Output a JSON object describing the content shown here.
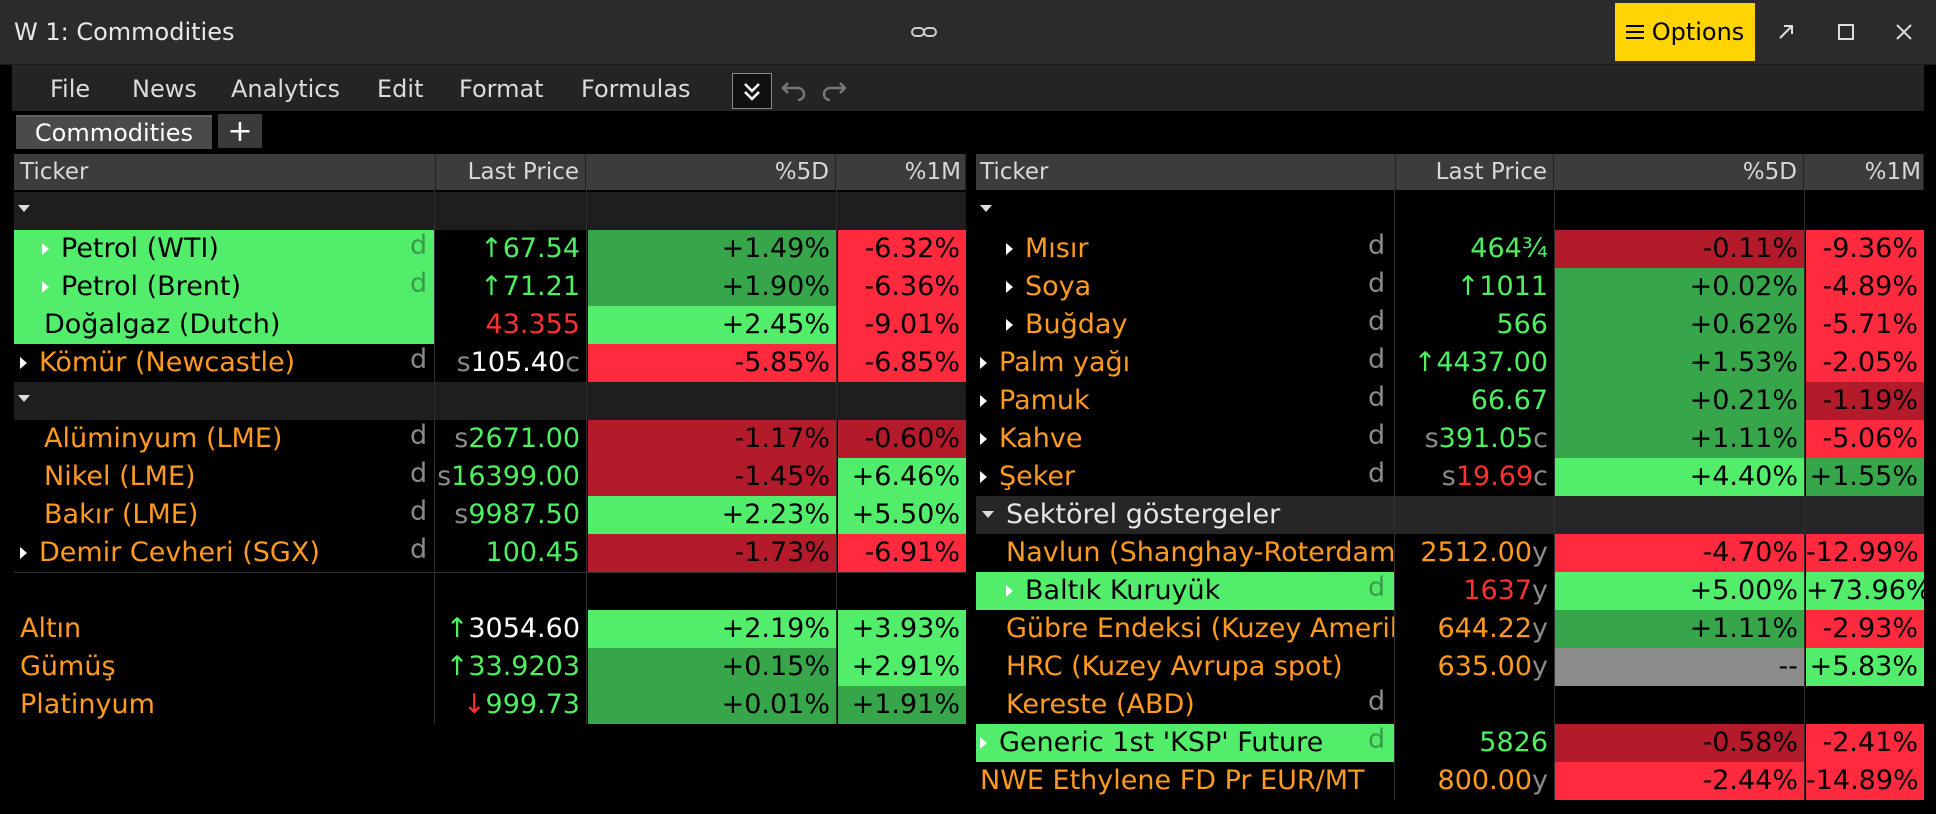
{
  "window": {
    "title": "W 1: Commodities",
    "options_label": "Options"
  },
  "menu": [
    "File",
    "News",
    "Analytics",
    "Edit",
    "Format",
    "Formulas"
  ],
  "tab": {
    "active": "Commodities",
    "add": "+"
  },
  "headers": {
    "ticker": "Ticker",
    "last": "Last Price",
    "d5": "%5D",
    "m1": "%1M"
  },
  "left": {
    "energy": [
      {
        "name": "Petrol (WTI)",
        "d": "d",
        "prefix": "↑",
        "price": "67.54",
        "suffix": "",
        "d5": "+1.49%",
        "m1": "-6.32%"
      },
      {
        "name": "Petrol (Brent)",
        "d": "d",
        "prefix": "↑",
        "price": "71.21",
        "suffix": "",
        "d5": "+1.90%",
        "m1": "-6.36%"
      },
      {
        "name": "Doğalgaz (Dutch)",
        "d": "",
        "prefix": "",
        "price": "43.355",
        "suffix": "",
        "d5": "+2.45%",
        "m1": "-9.01%"
      },
      {
        "name": "Kömür (Newcastle)",
        "d": "d",
        "prefix": "s",
        "price": "105.40",
        "suffix": "c",
        "d5": "-5.85%",
        "m1": "-6.85%"
      }
    ],
    "metals": [
      {
        "name": "Alüminyum (LME)",
        "d": "d",
        "prefix": "s",
        "price": "2671.00",
        "suffix": "",
        "d5": "-1.17%",
        "m1": "-0.60%"
      },
      {
        "name": "Nikel (LME)",
        "d": "d",
        "prefix": "s",
        "price": "16399.00",
        "suffix": "",
        "d5": "-1.45%",
        "m1": "+6.46%"
      },
      {
        "name": "Bakır (LME)",
        "d": "d",
        "prefix": "s",
        "price": "9987.50",
        "suffix": "",
        "d5": "+2.23%",
        "m1": "+5.50%"
      },
      {
        "name": "Demir Cevheri (SGX)",
        "d": "d",
        "prefix": "",
        "price": "100.45",
        "suffix": "",
        "d5": "-1.73%",
        "m1": "-6.91%"
      }
    ],
    "precious": [
      {
        "name": "Altın",
        "prefix": "↑",
        "price": "3054.60",
        "d5": "+2.19%",
        "m1": "+3.93%"
      },
      {
        "name": "Gümüş",
        "prefix": "↑",
        "price": "33.9203",
        "d5": "+0.15%",
        "m1": "+2.91%"
      },
      {
        "name": "Platinyum",
        "prefix": "↓",
        "price": "999.73",
        "d5": "+0.01%",
        "m1": "+1.91%"
      }
    ]
  },
  "right": {
    "agri": [
      {
        "name": "Mısır",
        "d": "d",
        "prefix": "",
        "price": "464¾",
        "suffix": "",
        "d5": "-0.11%",
        "m1": "-9.36%"
      },
      {
        "name": "Soya",
        "d": "d",
        "prefix": "↑",
        "price": "1011",
        "suffix": "",
        "d5": "+0.02%",
        "m1": "-4.89%"
      },
      {
        "name": "Buğday",
        "d": "d",
        "prefix": "",
        "price": "566",
        "suffix": "",
        "d5": "+0.62%",
        "m1": "-5.71%"
      },
      {
        "name": "Palm yağı",
        "d": "d",
        "prefix": "↑",
        "price": "4437.00",
        "suffix": "",
        "d5": "+1.53%",
        "m1": "-2.05%"
      },
      {
        "name": "Pamuk",
        "d": "d",
        "prefix": "",
        "price": "66.67",
        "suffix": "",
        "d5": "+0.21%",
        "m1": "-1.19%"
      },
      {
        "name": "Kahve",
        "d": "d",
        "prefix": "s",
        "price": "391.05",
        "suffix": "c",
        "d5": "+1.11%",
        "m1": "-5.06%"
      },
      {
        "name": "Şeker",
        "d": "d",
        "prefix": "s",
        "price": "19.69",
        "suffix": "c",
        "d5": "+4.40%",
        "m1": "+1.55%"
      }
    ],
    "sector_title": "Sektörel göstergeler",
    "sector": [
      {
        "name": "Navlun (Shanghay-Roterdam",
        "d": "",
        "price": "2512.00",
        "suffix": "y",
        "d5": "-4.70%",
        "m1": "-12.99%"
      },
      {
        "name": "Baltık Kuruyük",
        "d": "d",
        "price": "1637",
        "suffix": "y",
        "d5": "+5.00%",
        "m1": "+73.96%"
      },
      {
        "name": "Gübre Endeksi (Kuzey Amerika",
        "d": "",
        "price": "644.22",
        "suffix": "y",
        "d5": "+1.11%",
        "m1": "-2.93%"
      },
      {
        "name": "HRC (Kuzey Avrupa spot)",
        "d": "",
        "price": "635.00",
        "suffix": "y",
        "d5": "--",
        "m1": "+5.83%"
      },
      {
        "name": "Kereste (ABD)",
        "d": "d",
        "price": "",
        "suffix": "",
        "d5": "",
        "m1": ""
      },
      {
        "name": "Generic 1st 'KSP' Future",
        "d": "d",
        "price": "5826",
        "suffix": "",
        "d5": "-0.58%",
        "m1": "-2.41%"
      },
      {
        "name": "NWE Ethylene FD Pr EUR/MT",
        "d": "",
        "price": "800.00",
        "suffix": "y",
        "d5": "-2.44%",
        "m1": "-14.89%"
      }
    ]
  },
  "colors": {
    "bright_green": "#52ee6b",
    "green": "#37a54a",
    "red": "#ff2a3d",
    "dark_red": "#b31b2a",
    "orange": "#ff9a1f",
    "options_yellow": "#ffd400"
  }
}
